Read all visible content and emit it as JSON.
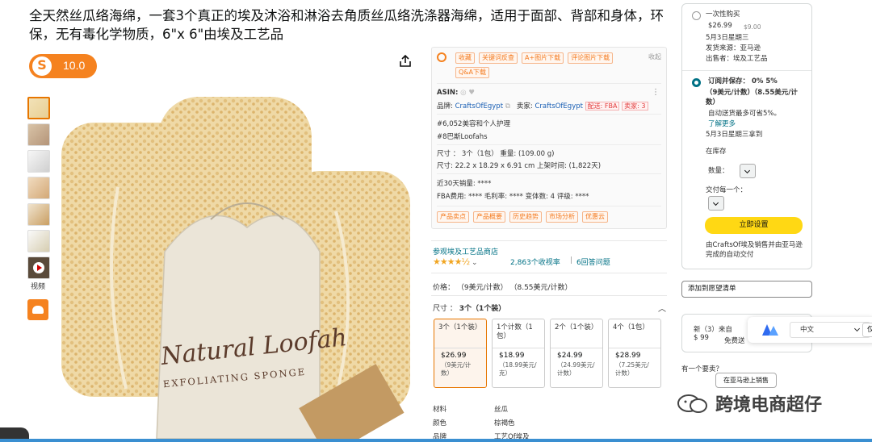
{
  "product": {
    "title": "全天然丝瓜络海绵，一套3个真正的埃及沐浴和淋浴去角质丝瓜络洗涤器海绵，适用于面部、背部和身体，环保，无有毒化学物质，6\"x 6\"由埃及工艺品",
    "score": "10.0",
    "video_label": "视频",
    "bag_text_1": "Natural Loofah",
    "bag_text_2": "EXFOLIATING SPONGE"
  },
  "tool_panel": {
    "tags_row1": [
      "收藏",
      "关键词反查",
      "A+图片下载",
      "评论图片下载"
    ],
    "tags_row2": [
      "Q&A下载"
    ],
    "fold": "收起",
    "asin_label": "ASIN:",
    "brand_label": "品牌:",
    "brand_value": "CraftsOfEgypt",
    "seller_label": "卖家:",
    "seller_value": "CraftsOfEgypt",
    "fba_tag": "配送: FBA",
    "seller_count_tag": "卖家: 3",
    "rank1": "#6,052美容和个人护理",
    "rank2": "#8巴斯Loofahs",
    "size_line": "尺寸 ：  3个（1包）     重量: (109.00 g)",
    "dim_line": "尺寸: 22.2 x 18.29 x 6.91 cm     上架时间: (1,822天)",
    "sales_line": "近30天销量: ****",
    "fee_line": "FBA费用: ****     毛利率: ****     变体数: 4     评级: ****",
    "bottom_tags": [
      "产品卖点",
      "产品概要",
      "历史趋势",
      "市场分析",
      "优惠云"
    ]
  },
  "listing": {
    "store_link": "参观埃及工艺品商店",
    "stars": "★★★★½",
    "ratings": "2,863个收视率",
    "answers": "6回答问题",
    "price_line": "价格：  （9美元/计数）  （8.55美元/计数）",
    "size_label": "尺寸 ：",
    "size_value": "3个（1个装）",
    "options": [
      {
        "name": "3个（1个装）",
        "price": "$26.99",
        "unit": "（9美元/计数）"
      },
      {
        "name": "1个计数（1包）",
        "price": "$18.99",
        "unit": "（18.99美元/克）"
      },
      {
        "name": "2个（1个装）",
        "price": "$24.99",
        "unit": "（24.99美元/计数）"
      },
      {
        "name": "4个（1包）",
        "price": "$28.99",
        "unit": "（7.25美元/计数）"
      }
    ],
    "specs": [
      {
        "label": "材料",
        "value": "丝瓜"
      },
      {
        "label": "颜色",
        "value": "棕褐色"
      },
      {
        "label": "品牌",
        "value": "工艺Of埃及"
      }
    ]
  },
  "buybox": {
    "once_label": "一次性购买",
    "once_price": "$26.99",
    "once_unit": "$9.00",
    "once_date": "5月3日星期三",
    "ship_from": "发货来源：亚马逊",
    "sold_by": "出售者：埃及工艺品",
    "sub_title": "订阅并保存：   0% 5%",
    "sub_price": "（9美元/计数）（8.55美元/计数）",
    "sub_note": "自动送货最多可省5%。",
    "learn_more": "了解更多",
    "sub_date": "5月3日星期三拿到",
    "in_stock": "在库存",
    "qty_label": "数量：",
    "deliver_every": "交付每一个：",
    "setup_btn": "立即设置",
    "fulfilled_note": "由CraftsOf埃及销售并由亚马逊完成的自动交付"
  },
  "side": {
    "wishlist": "添加到愿望清单",
    "new_label": "新（3）来自",
    "new_price": "$ 99",
    "free_ship": "免费送",
    "question": "有一个要卖？",
    "sell_btn": "在亚马逊上销售"
  },
  "translate": {
    "lang": "中文",
    "more": "仅"
  },
  "watermark": {
    "text": "跨境电商超仔"
  },
  "colors": {
    "accent_orange": "#f5821f",
    "link_teal": "#007185",
    "buy_yellow": "#ffd814",
    "star_gold": "#f1a624"
  }
}
